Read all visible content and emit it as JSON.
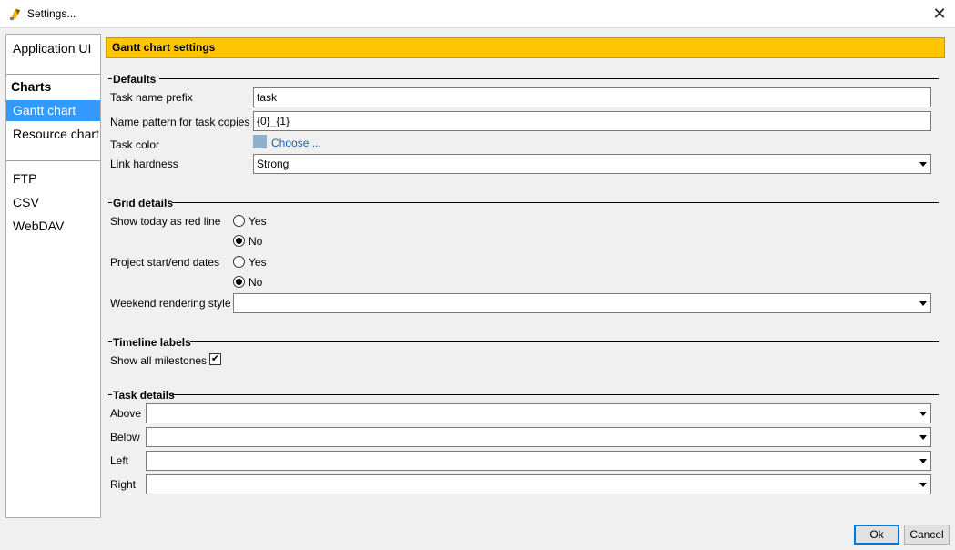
{
  "window": {
    "title": "Settings..."
  },
  "nav": {
    "items": [
      {
        "label": "Application UI"
      },
      {
        "label": "Charts"
      },
      {
        "label": "Gantt chart"
      },
      {
        "label": "Resource chart"
      },
      {
        "label": "FTP"
      },
      {
        "label": "CSV"
      },
      {
        "label": "WebDAV"
      }
    ],
    "selected": "Gantt chart"
  },
  "panel": {
    "title": "Gantt chart settings"
  },
  "defaults": {
    "title": "Defaults",
    "task_name_prefix": {
      "label": "Task name prefix",
      "value": "task"
    },
    "name_pattern": {
      "label": "Name pattern for task copies",
      "value": "{0}_{1}"
    },
    "task_color": {
      "label": "Task color",
      "link": "Choose ...",
      "color": "#8fb0cf"
    },
    "link_hardness": {
      "label": "Link hardness",
      "value": "Strong"
    }
  },
  "grid": {
    "title": "Grid details",
    "today_line": {
      "label": "Show today as red line",
      "yes": "Yes",
      "no": "No",
      "selected": "No"
    },
    "project_dates": {
      "label": "Project start/end dates",
      "yes": "Yes",
      "no": "No",
      "selected": "No"
    },
    "weekend_style": {
      "label": "Weekend rendering style",
      "value": ""
    }
  },
  "timeline": {
    "title": "Timeline labels",
    "show_milestones": {
      "label": "Show all milestones",
      "checked": true
    }
  },
  "task_details": {
    "title": "Task details",
    "above": {
      "label": "Above",
      "value": ""
    },
    "below": {
      "label": "Below",
      "value": ""
    },
    "left": {
      "label": "Left",
      "value": ""
    },
    "right": {
      "label": "Right",
      "value": ""
    }
  },
  "buttons": {
    "ok": "Ok",
    "cancel": "Cancel"
  },
  "icons": {
    "app": "app-logo-icon",
    "close": "close-icon",
    "check": "check-icon",
    "dropdown": "chevron-down-icon"
  },
  "colors": {
    "header": "#ffc600",
    "selection": "#3399ff"
  }
}
